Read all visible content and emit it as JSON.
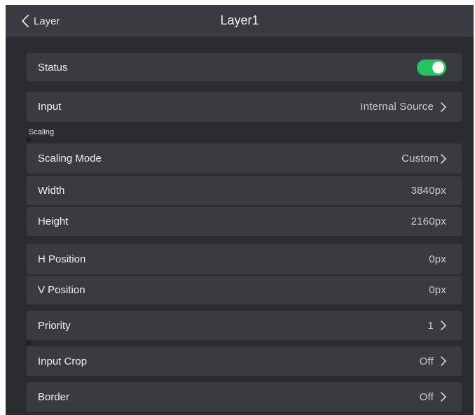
{
  "header": {
    "back_label": "Layer",
    "title": "Layer1"
  },
  "status": {
    "label": "Status",
    "enabled": true
  },
  "input": {
    "label": "Input",
    "value": "Internal Source"
  },
  "scaling_section": {
    "label": "Scaling"
  },
  "scaling_mode": {
    "label": "Scaling Mode",
    "value": "Custom"
  },
  "width": {
    "label": "Width",
    "value": "3840px"
  },
  "height": {
    "label": "Height",
    "value": "2160px"
  },
  "h_position": {
    "label": "H Position",
    "value": "0px"
  },
  "v_position": {
    "label": "V Position",
    "value": "0px"
  },
  "priority": {
    "label": "Priority",
    "value": "1"
  },
  "input_crop": {
    "label": "Input Crop",
    "value": "Off"
  },
  "border": {
    "label": "Border",
    "value": "Off"
  },
  "colors": {
    "toggle_on": "#22c55e",
    "background": "#2b2c30",
    "row_background": "#3a3b41"
  }
}
